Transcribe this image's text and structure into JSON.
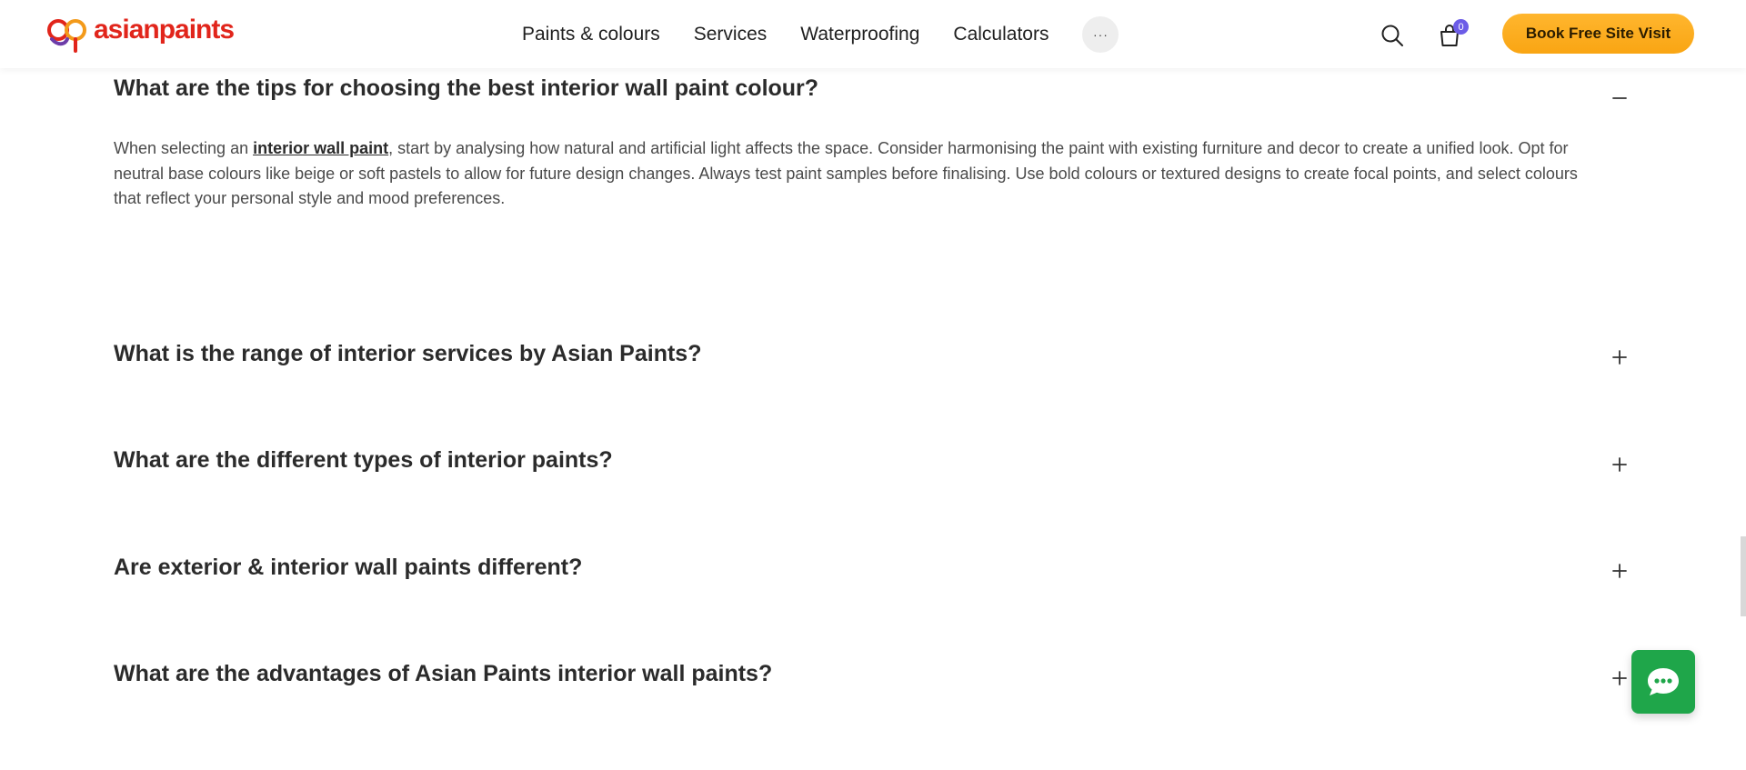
{
  "header": {
    "logo_text": "asianpaints",
    "nav": [
      "Paints & colours",
      "Services",
      "Waterproofing",
      "Calculators"
    ],
    "more_label": "···",
    "cart_count": "0",
    "cta_label": "Book Free Site Visit"
  },
  "faq": {
    "items": [
      {
        "question": "What are the tips for choosing the best interior wall paint colour?",
        "expanded": true,
        "answer_before": "When selecting an ",
        "answer_link": "interior wall paint",
        "answer_after": ", start by analysing how natural and artificial light affects the space. Consider harmonising the paint with existing furniture and decor to create a unified look. Opt for neutral base colours like beige or soft pastels to allow for future design changes. Always test paint samples before finalising. Use bold colours or textured designs to create focal points, and select colours that reflect your personal style and mood preferences."
      },
      {
        "question": "What is the range of interior services by Asian Paints?",
        "expanded": false
      },
      {
        "question": "What are the different types of interior paints?",
        "expanded": false
      },
      {
        "question": "Are exterior & interior wall paints different?",
        "expanded": false
      },
      {
        "question": "What are the advantages of Asian Paints interior wall paints?",
        "expanded": false
      }
    ]
  },
  "colors": {
    "brand_red": "#e1251b",
    "cta_orange": "#f9a513",
    "badge_purple": "#6c5ce7",
    "chat_green": "#1fa64a"
  },
  "icons": [
    "search-icon",
    "cart-icon",
    "minus-icon",
    "plus-icon",
    "chat-icon"
  ]
}
